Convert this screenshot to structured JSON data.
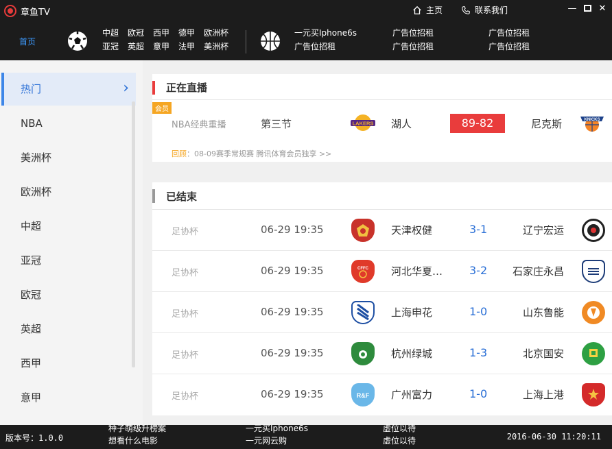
{
  "window": {
    "title": "章鱼TV",
    "home_label": "主页",
    "contact_label": "联系我们"
  },
  "nav": {
    "home": "首页",
    "football_leagues": [
      "中超",
      "欧冠",
      "西甲",
      "德甲",
      "欧洲杯",
      "亚冠",
      "英超",
      "意甲",
      "法甲",
      "美洲杯"
    ],
    "ads": {
      "col1": [
        "一元买Iphone6s",
        "广告位招租"
      ],
      "col2": [
        "广告位招租",
        "广告位招租"
      ],
      "col3": [
        "广告位招租",
        "广告位招租"
      ]
    }
  },
  "sidebar": {
    "items": [
      "热门",
      "NBA",
      "美洲杯",
      "欧洲杯",
      "中超",
      "亚冠",
      "欧冠",
      "英超",
      "西甲",
      "意甲"
    ],
    "active_index": 0
  },
  "live": {
    "title": "正在直播",
    "vip_badge": "会员",
    "match": {
      "league": "NBA经典重播",
      "period": "第三节",
      "home_team": "湖人",
      "score": "89-82",
      "away_team": "尼克斯",
      "home_logo_text": "LAKERS",
      "away_logo_text": "KNICKS"
    },
    "replay_label": "回顾",
    "replay_text": "：08-09赛季常规赛 腾讯体育会员独享 >>"
  },
  "ended": {
    "title": "已结束",
    "matches": [
      {
        "league": "足协杯",
        "time": "06-29 19:35",
        "home": "天津权健",
        "score": "3-1",
        "away": "辽宁宏运"
      },
      {
        "league": "足协杯",
        "time": "06-29 19:35",
        "home": "河北华夏幸福",
        "score": "3-2",
        "away": "石家庄永昌"
      },
      {
        "league": "足协杯",
        "time": "06-29 19:35",
        "home": "上海申花",
        "score": "1-0",
        "away": "山东鲁能"
      },
      {
        "league": "足协杯",
        "time": "06-29 19:35",
        "home": "杭州绿城",
        "score": "1-3",
        "away": "北京国安"
      },
      {
        "league": "足协杯",
        "time": "06-29 19:35",
        "home": "广州富力",
        "score": "1-0",
        "away": "上海上港"
      }
    ]
  },
  "statusbar": {
    "version": "版本号：1.0.0",
    "col1": [
      "种子萌级升榜案",
      "想看什么电影"
    ],
    "col2": [
      "一元买Iphone6s",
      "一元网云购"
    ],
    "col3": [
      "虚位以待",
      "虚位以待"
    ],
    "datetime": "2016-06-30 11:20:11"
  },
  "colors": {
    "accent_blue": "#2a6fd6",
    "live_score_red": "#e93c3c",
    "vip_orange": "#f5a623",
    "title_bar": "#1c1c1c"
  }
}
